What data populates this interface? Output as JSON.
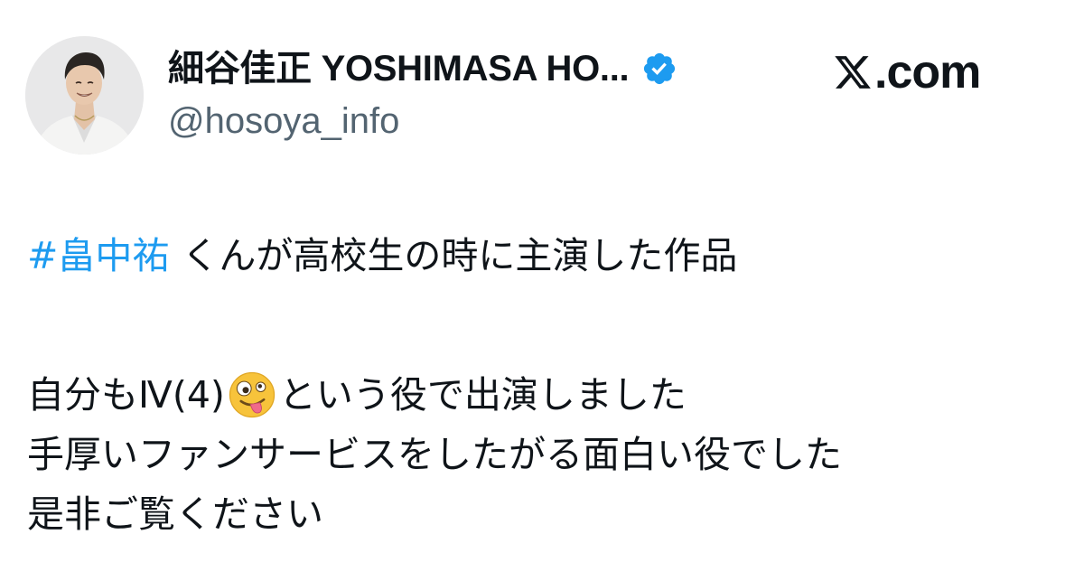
{
  "author": {
    "display_name": "細谷佳正 YOSHIMASA HO...",
    "handle": "@hosoya_info",
    "verified": true,
    "verified_color": "#1d9bf0",
    "avatar_icon": "avatar-photo"
  },
  "brand": {
    "text": "X.com",
    "logo_icon": "x-logo-icon",
    "suffix": ".com"
  },
  "tweet": {
    "hashtag": "#畠中祐",
    "line1_rest": "くんが高校生の時に主演した作品",
    "line2_before_emoji": "自分もⅣ(4)",
    "emoji": "zany-face-emoji",
    "line2_after_emoji": "という役で出演しました",
    "line3": "手厚いファンサービスをしたがる面白い役でした",
    "line4": "是非ご覧ください",
    "hashtag_color": "#1d9bf0",
    "text_color": "#0f1419"
  }
}
